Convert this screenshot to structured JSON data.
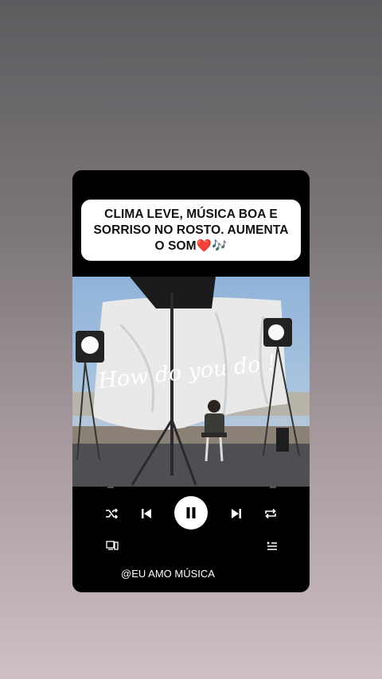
{
  "caption": {
    "line1": "CLIMA LEVE, MÚSICA BOA E",
    "line2": "SORRISO NO ROSTO. AUMENTA",
    "line3": "O SOM❤️🎶"
  },
  "video": {
    "overlay_text": "How do you do !"
  },
  "player": {
    "shuffle_icon": "shuffle-icon",
    "previous_icon": "skip-previous-icon",
    "play_pause_icon": "pause-icon",
    "next_icon": "skip-next-icon",
    "repeat_icon": "repeat-icon",
    "devices_icon": "devices-icon",
    "queue_icon": "queue-icon"
  },
  "handle": "@EU AMO MÚSICA"
}
